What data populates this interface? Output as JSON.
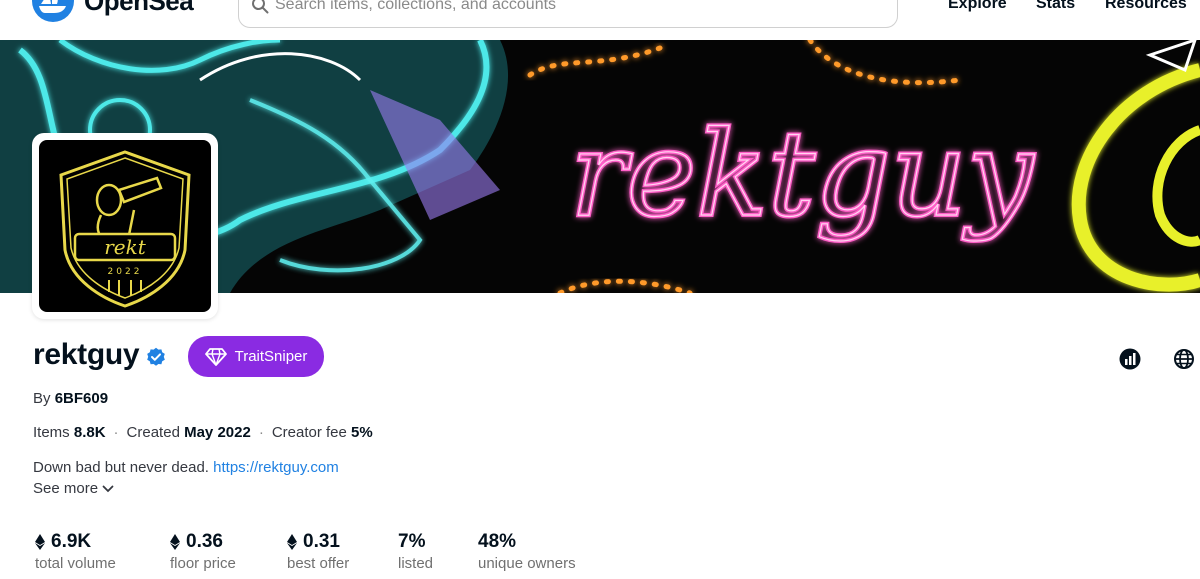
{
  "header": {
    "logo_text": "OpenSea",
    "search_placeholder": "Search items, collections, and accounts",
    "nav": [
      "Explore",
      "Stats",
      "Resources"
    ]
  },
  "banner": {
    "art_text": "rektguy"
  },
  "avatar": {
    "badge_text": "rekt",
    "year_text": "2022"
  },
  "collection": {
    "name": "rektguy",
    "verified": true,
    "trait_button": "TraitSniper",
    "by_label": "By",
    "creator": "6BF609",
    "items_label": "Items",
    "items_value": "8.8K",
    "created_label": "Created",
    "created_value": "May 2022",
    "fee_label": "Creator fee",
    "fee_value": "5%",
    "description": "Down bad but never dead.",
    "link": "https://rektguy.com",
    "see_more": "See more"
  },
  "stats": [
    {
      "value": "6.9K",
      "label": "total volume",
      "eth": true
    },
    {
      "value": "0.36",
      "label": "floor price",
      "eth": true
    },
    {
      "value": "0.31",
      "label": "best offer",
      "eth": true
    },
    {
      "value": "7%",
      "label": "listed",
      "eth": false
    },
    {
      "value": "48%",
      "label": "unique owners",
      "eth": false
    }
  ],
  "colors": {
    "brand_blue": "#2081e2",
    "trait_purple": "#8a2be2",
    "banner_bg": "#050505",
    "neon_pink": "#ff5fc8",
    "neon_cyan": "#4de8e8",
    "neon_yellow": "#e8f02a"
  },
  "icons": [
    "search-icon",
    "verified-icon",
    "diamond-icon",
    "chart-icon",
    "globe-icon",
    "chevron-down-icon",
    "eth-icon"
  ]
}
